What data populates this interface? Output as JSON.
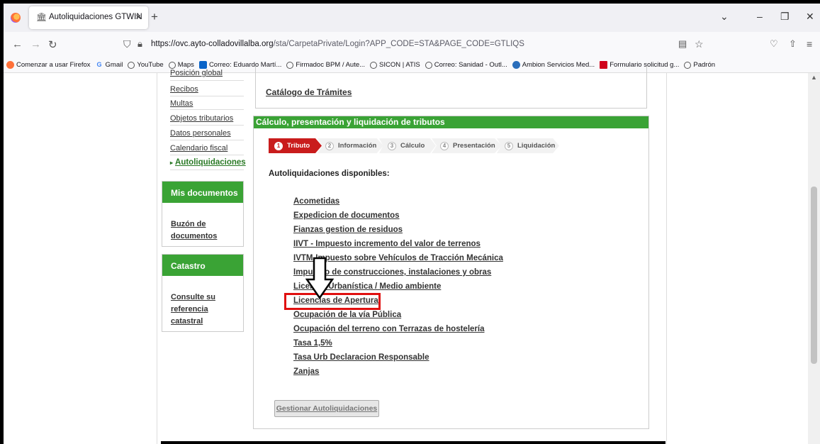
{
  "browser": {
    "tab_title": "Autoliquidaciones GTWIN",
    "tab_close": "×",
    "new_tab": "+",
    "url_host": "https://ovc.ayto-colladovillalba.org",
    "url_path": "/sta/CarpetaPrivate/Login?APP_CODE=STA&PAGE_CODE=GTLIQS",
    "bookmarks": [
      {
        "label": "Comenzar a usar Firefox",
        "icon": "firefox-icon"
      },
      {
        "label": "Gmail",
        "icon": "google-icon"
      },
      {
        "label": "YouTube",
        "icon": "globe-icon"
      },
      {
        "label": "Maps",
        "icon": "globe-icon"
      },
      {
        "label": "Correo: Eduardo Martí...",
        "icon": "outlook-icon"
      },
      {
        "label": "Firmadoc BPM / Aute...",
        "icon": "globe-icon"
      },
      {
        "label": "SICON | ATIS",
        "icon": "globe-icon"
      },
      {
        "label": "Correo: Sanidad - Outl...",
        "icon": "globe-icon"
      },
      {
        "label": "Ambion Servicios Med...",
        "icon": "wordpress-icon"
      },
      {
        "label": "Formulario solicitud g...",
        "icon": "form-icon"
      },
      {
        "label": "Padrón",
        "icon": "globe-icon"
      }
    ]
  },
  "sidebar": {
    "partial_item": "Posición global",
    "items": [
      {
        "label": "Recibos"
      },
      {
        "label": "Multas"
      },
      {
        "label": "Objetos tributarios"
      },
      {
        "label": "Datos personales"
      },
      {
        "label": "Calendario fiscal"
      },
      {
        "label": "Autoliquidaciones"
      }
    ],
    "mis_documentos": {
      "title": "Mis documentos",
      "link_line1": "Buzón de",
      "link_line2": "documentos"
    },
    "catastro": {
      "title": "Catastro",
      "link_line1": "Consulte su",
      "link_line2": "referencia",
      "link_line3": "catastral"
    }
  },
  "main": {
    "catalogo_link": "Catálogo de Trámites",
    "panel_title": "Cálculo, presentación y liquidación de tributos",
    "steps": [
      {
        "num": "1",
        "label": "Tributo"
      },
      {
        "num": "2",
        "label": "Información"
      },
      {
        "num": "3",
        "label": "Cálculo"
      },
      {
        "num": "4",
        "label": "Presentación"
      },
      {
        "num": "5",
        "label": "Liquidación"
      }
    ],
    "available_label": "Autoliquidaciones disponibles:",
    "items": [
      {
        "label": "Acometidas"
      },
      {
        "label": "Expedicion de documentos"
      },
      {
        "label": "Fianzas gestion de residuos"
      },
      {
        "label": "IIVT - Impuesto incremento del valor de terrenos"
      },
      {
        "label": "IVTM-Impuesto sobre Vehículos de Tracción Mecánica"
      },
      {
        "label": "Impuesto de construcciones, instalaciones y obras"
      },
      {
        "label": "Licencia Urbanística / Medio ambiente"
      },
      {
        "label": "Licencias de Apertura"
      },
      {
        "label": "Ocupación de la vía Pública"
      },
      {
        "label": "Ocupación del terreno con Terrazas de hostelería"
      },
      {
        "label": "Tasa 1,5%"
      },
      {
        "label": "Tasa Urb Declaracion Responsable"
      },
      {
        "label": "Zanjas"
      }
    ],
    "gestionar_button": "Gestionar Autoliquidaciones"
  },
  "annotation": {
    "highlight_color": "#e01010",
    "arrow_color": "#000000"
  }
}
